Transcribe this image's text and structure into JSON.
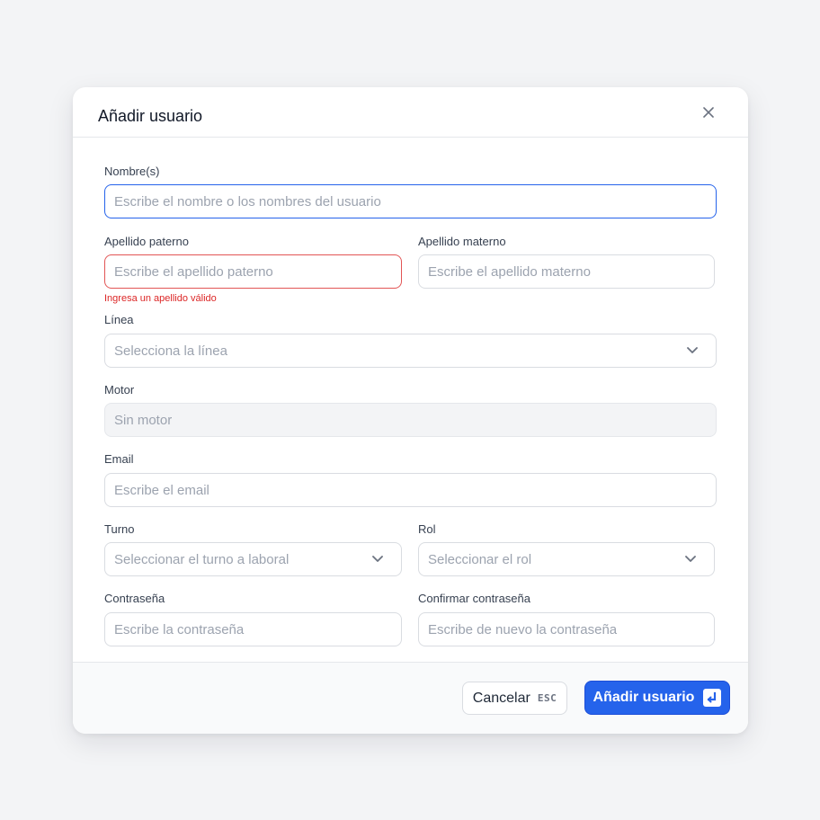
{
  "modal": {
    "title": "Añadir usuario"
  },
  "form": {
    "nombre": {
      "label": "Nombre(s)",
      "placeholder": "Escribe el nombre o los nombres del usuario"
    },
    "apellido_paterno": {
      "label": "Apellido paterno",
      "placeholder": "Escribe el apellido paterno",
      "error": "Ingresa un apellido válido"
    },
    "apellido_materno": {
      "label": "Apellido materno",
      "placeholder": "Escribe el apellido materno"
    },
    "linea": {
      "label": "Línea",
      "placeholder": "Selecciona la línea"
    },
    "motor": {
      "label": "Motor",
      "value": "Sin motor"
    },
    "email": {
      "label": "Email",
      "placeholder": "Escribe el email"
    },
    "turno": {
      "label": "Turno",
      "placeholder": "Seleccionar el turno a laboral"
    },
    "rol": {
      "label": "Rol",
      "placeholder": "Seleccionar el rol"
    },
    "contrasena": {
      "label": "Contraseña",
      "placeholder": "Escribe la contraseña"
    },
    "confirmar": {
      "label": "Confirmar contraseña",
      "placeholder": "Escribe de nuevo la contraseña"
    }
  },
  "footer": {
    "cancel_label": "Cancelar",
    "cancel_shortcut": "ESC",
    "submit_label": "Añadir usuario"
  },
  "icons": {
    "close": "close-icon",
    "chevron": "chevron-down-icon",
    "enter": "enter-key-icon"
  },
  "colors": {
    "primary": "#2563eb",
    "focus_border": "#2563eb",
    "error": "#dc2626",
    "background": "#f3f4f6"
  }
}
